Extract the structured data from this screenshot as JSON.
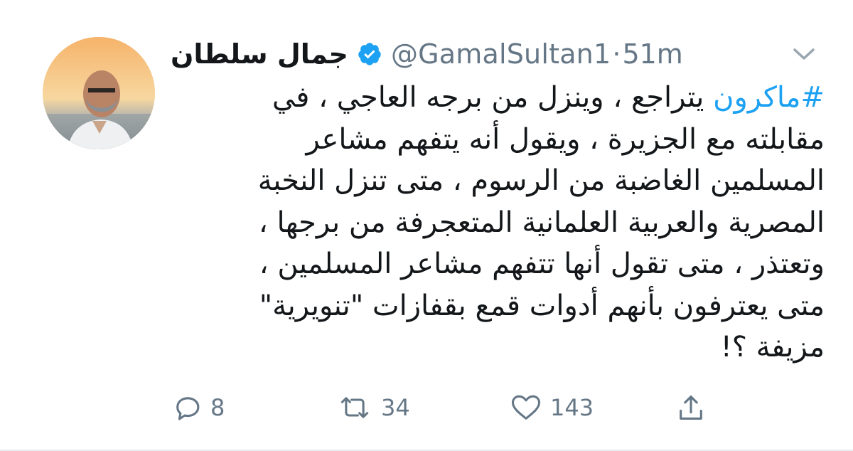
{
  "tweet": {
    "display_name": "جمال سلطان",
    "handle": "@GamalSultan1",
    "separator": "·",
    "time": "51m",
    "body": {
      "line1_hashtag": "#ماكرون",
      "line1_rest": " يتراجع ، وينزل من برجه العاجي ، في",
      "line2": "مقابلته مع الجزيرة ، ويقول أنه يتفهم مشاعر",
      "line3": "المسلمين الغاضبة من الرسوم ، متى تنزل النخبة",
      "line4": "المصرية والعربية العلمانية المتعجرفة من برجها ،",
      "line5": "وتعتذر ، متى تقول أنها تتفهم مشاعر المسلمين ،",
      "line6": "متى يعترفون بأنهم أدوات قمع بقفازات \"تنويرية\"",
      "line7": "مزيفة ؟!"
    },
    "actions": {
      "replies": "8",
      "retweets": "34",
      "likes": "143"
    },
    "icons": {
      "verified": "verified-badge-icon",
      "chevron": "chevron-down-icon",
      "reply": "reply-icon",
      "retweet": "retweet-icon",
      "like": "heart-icon",
      "share": "share-icon"
    },
    "colors": {
      "link": "#1da1f2",
      "text": "#14171a",
      "muted": "#657786"
    }
  }
}
